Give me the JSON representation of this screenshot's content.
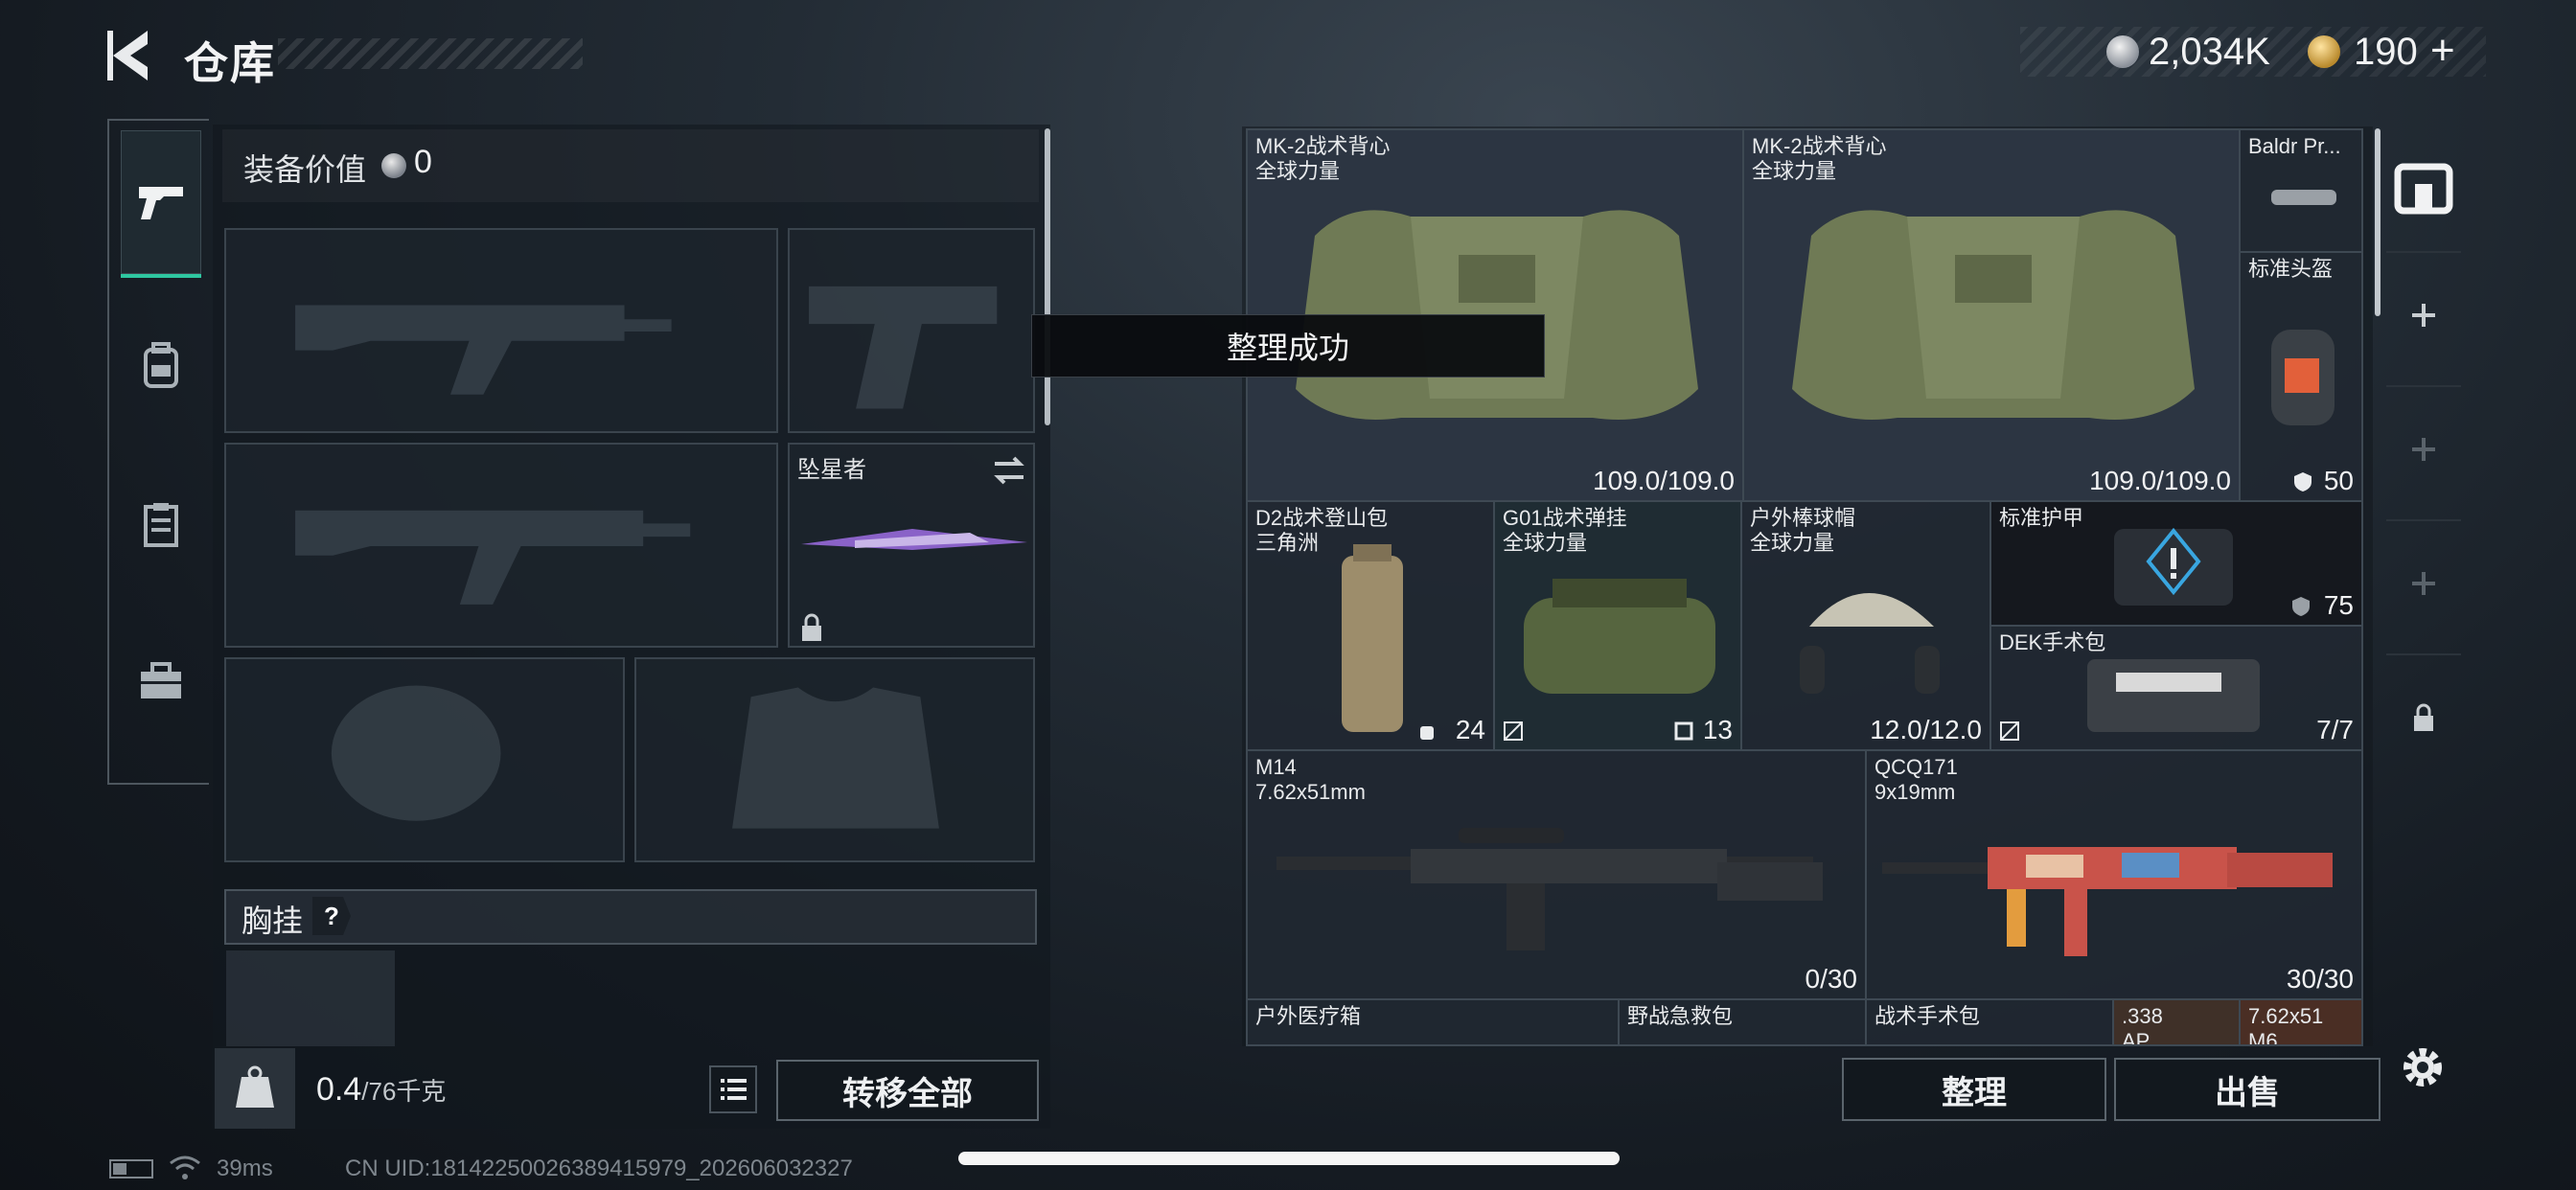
{
  "header": {
    "title": "仓库",
    "silver_amount": "2,034K",
    "gold_amount": "190",
    "gold_plus": "+"
  },
  "tabs": [
    {
      "name": "firearms-tab-icon"
    },
    {
      "name": "backpack-tab-icon"
    },
    {
      "name": "clipboard-tab-icon"
    },
    {
      "name": "toolbox-tab-icon"
    }
  ],
  "loadout": {
    "equip_value_label": "装备价值",
    "equip_value": "0",
    "melee_name": "坠星者",
    "chest_rig_label": "胸挂",
    "chest_rig_help": "?",
    "weight_value": "0.4",
    "weight_unit": "/76千克",
    "transfer_all": "转移全部"
  },
  "toast": "整理成功",
  "inventory": {
    "items": [
      {
        "name": "MK-2战术背心",
        "sub": "全球力量",
        "value": "109.0/109.0"
      },
      {
        "name": "MK-2战术背心",
        "sub": "全球力量",
        "value": "109.0/109.0"
      },
      {
        "name": "Baldr Pr...",
        "sub": "",
        "value": ""
      },
      {
        "name": "标准头盔",
        "sub": "",
        "value": "50"
      },
      {
        "name": "D2战术登山包",
        "sub": "三角洲",
        "value": "24"
      },
      {
        "name": "G01战术弹挂",
        "sub": "全球力量",
        "value": "13"
      },
      {
        "name": "户外棒球帽",
        "sub": "全球力量",
        "value": "12.0/12.0"
      },
      {
        "name": "标准护甲",
        "sub": "",
        "value": "75"
      },
      {
        "name": "DEK手术包",
        "sub": "",
        "value": "7/7"
      },
      {
        "name": "M14",
        "sub": "7.62x51mm",
        "value": "0/30"
      },
      {
        "name": "QCQ171",
        "sub": "9x19mm",
        "value": "30/30"
      },
      {
        "name": "户外医疗箱",
        "sub": "",
        "value": ""
      },
      {
        "name": "野战急救包",
        "sub": "",
        "value": ""
      },
      {
        "name": "战术手术包",
        "sub": "",
        "value": ""
      },
      {
        "name": ".338",
        "sub": "AP",
        "value": ""
      },
      {
        "name": "7.62x51",
        "sub": "M6",
        "value": ""
      }
    ]
  },
  "actions": {
    "sort": "整理",
    "sell": "出售"
  },
  "status_bar": {
    "ping": "39ms",
    "uid": "CN UID:18142250026389415979_202606032327"
  },
  "colors": {
    "accent": "#2ec7a1",
    "background": "#1b232b"
  }
}
